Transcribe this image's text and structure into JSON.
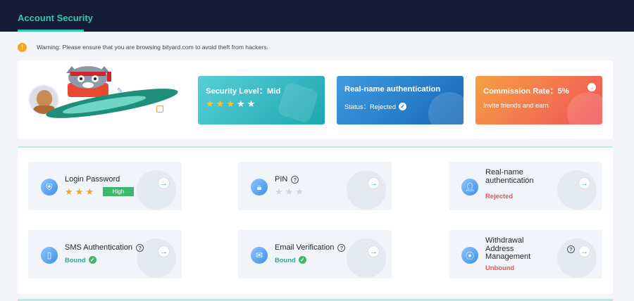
{
  "header": {
    "tab_label": "Account Security"
  },
  "warning": {
    "icon": "warning-icon",
    "text": "Warning: Please ensure that you are browsing bityard.com to avoid theft from hackers."
  },
  "profile": {
    "avatar": "user-avatar",
    "edit_icon": "edit-icon",
    "copy_icon": "copy-icon"
  },
  "panels": {
    "security": {
      "title": "Security Level：Mid",
      "stars_filled": 3,
      "stars_total": 5
    },
    "realname": {
      "title": "Real-name authentication",
      "status": "Status：Rejected"
    },
    "commission": {
      "title": "Commission Rate：5%",
      "subtitle": "Invite friends and earn"
    }
  },
  "items": {
    "login": {
      "title": "Login Password",
      "stars_filled": 3,
      "stars_total": 3,
      "level": "High"
    },
    "pin": {
      "title": "PIN",
      "stars_filled": 0,
      "stars_total": 3
    },
    "realname": {
      "title": "Real-name authentication",
      "status": "Rejected"
    },
    "sms": {
      "title": "SMS Authentication",
      "status": "Bound"
    },
    "email": {
      "title": "Email Verification",
      "status": "Bound"
    },
    "withdrawal": {
      "title": "Withdrawal Address Management",
      "status": "Unbound"
    }
  },
  "colors": {
    "accent": "#2ec9b6",
    "header_bg": "#141c36",
    "bound": "#2aab8e",
    "rejected": "#f0525a"
  }
}
